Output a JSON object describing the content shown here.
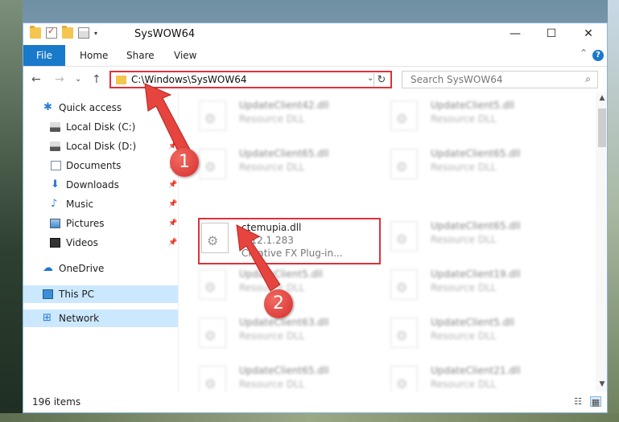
{
  "window": {
    "title": "SysWOW64",
    "controls": {
      "minimize": "—",
      "maximize": "☐",
      "close": "✕"
    }
  },
  "ribbon": {
    "tabs": [
      "File",
      "Home",
      "Share",
      "View"
    ],
    "collapse_glyph": "⌃",
    "help_glyph": "?"
  },
  "address_bar": {
    "path": "C:\\Windows\\SysWOW64",
    "dropdown_glyph": "⌄",
    "refresh_glyph": "↻",
    "nav_glyphs": {
      "back": "←",
      "forward": "→",
      "recent": "⌄",
      "up": "↑"
    }
  },
  "search": {
    "placeholder": "Search SysWOW64",
    "glyph": "⌕"
  },
  "sidebar": {
    "items": [
      {
        "label": "Quick access",
        "icon": "star-icon",
        "glyph": "✱",
        "pinned": false
      },
      {
        "label": "Local Disk (C:)",
        "icon": "disk-icon",
        "pinned": false
      },
      {
        "label": "Local Disk (D:)",
        "icon": "disk-icon",
        "pinned": true
      },
      {
        "label": "Documents",
        "icon": "document-icon",
        "pinned": true
      },
      {
        "label": "Downloads",
        "icon": "download-icon",
        "glyph": "⬇",
        "pinned": true
      },
      {
        "label": "Music",
        "icon": "music-icon",
        "glyph": "♪",
        "pinned": true
      },
      {
        "label": "Pictures",
        "icon": "pictures-icon",
        "pinned": true
      },
      {
        "label": "Videos",
        "icon": "video-icon",
        "pinned": true
      },
      {
        "label": "OneDrive",
        "icon": "cloud-icon",
        "glyph": "☁",
        "pinned": false
      },
      {
        "label": "This PC",
        "icon": "computer-icon",
        "pinned": false,
        "selected": true
      },
      {
        "label": "Network",
        "icon": "network-icon",
        "glyph": "⊞",
        "pinned": false
      }
    ],
    "pin_glyph": "📌"
  },
  "files": {
    "left_column": [
      {
        "name": "UpdateClient42.dll",
        "type": "Resource DLL"
      },
      {
        "name": "UpdateClient65.dll",
        "type": "Resource DLL"
      },
      {
        "name": "ctemupia.dll",
        "type": "5.12.1.283",
        "desc": "Creative FX Plug-in..."
      },
      {
        "name": "UpdateClient5.dll",
        "type": "Resource DLL"
      },
      {
        "name": "UpdateClient63.dll",
        "type": "Resource DLL"
      },
      {
        "name": "UpdateClient65.dll",
        "type": "Resource DLL"
      }
    ],
    "right_column": [
      {
        "name": "UpdateClient5.dll",
        "type": "Resource DLL"
      },
      {
        "name": "UpdateClient65.dll",
        "type": "Resource DLL"
      },
      {
        "name": "UpdateClient65.dll",
        "type": "Resource DLL"
      },
      {
        "name": "UpdateClient19.dll",
        "type": "Resource DLL"
      },
      {
        "name": "UpdateClient5.dll",
        "type": "Resource DLL"
      },
      {
        "name": "UpdateClient21.dll",
        "type": "Resource DLL"
      }
    ]
  },
  "status": {
    "item_count": "196 items",
    "view_glyphs": [
      "☷",
      "▦"
    ]
  },
  "callouts": [
    "1",
    "2"
  ],
  "colors": {
    "accent": "#1979ca",
    "highlight": "#e0303a",
    "selected": "#cce8ff"
  }
}
